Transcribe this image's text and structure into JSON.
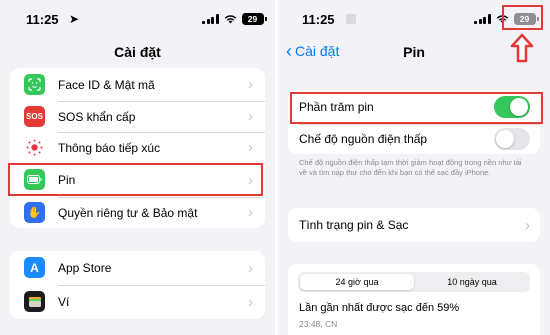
{
  "colors": {
    "accent": "#007aff",
    "toggle_on": "#34c759",
    "highlight": "#e53935",
    "face_id_icon": "#34c759",
    "sos_icon": "#e53935",
    "exposure_icon": "#ffffff",
    "battery_icon": "#34c759",
    "privacy_icon": "#2f6ff0",
    "app_store_icon": "#1a8cff",
    "wallet_icon": "#1c1c1e"
  },
  "left": {
    "status": {
      "time": "11:25",
      "battery": "29"
    },
    "nav_title": "Cài đặt",
    "group1": [
      {
        "label": "Face ID & Mật mã",
        "icon": "face-id-icon",
        "glyph": "☺"
      },
      {
        "label": "SOS khẩn cấp",
        "icon": "sos-icon",
        "glyph": "SOS"
      },
      {
        "label": "Thông báo tiếp xúc",
        "icon": "exposure-notification-icon",
        "glyph": ""
      },
      {
        "label": "Pin",
        "icon": "battery-icon",
        "glyph": ""
      },
      {
        "label": "Quyền riêng tư & Bảo mật",
        "icon": "privacy-hand-icon",
        "glyph": "✋"
      }
    ],
    "group2": [
      {
        "label": "App Store",
        "icon": "app-store-icon",
        "glyph": "A"
      },
      {
        "label": "Ví",
        "icon": "wallet-icon",
        "glyph": ""
      }
    ]
  },
  "right": {
    "status": {
      "time": "11:25",
      "battery": "29"
    },
    "back_label": "Cài đặt",
    "nav_title": "Pin",
    "battery_percentage": {
      "label": "Phần trăm pin",
      "enabled": true
    },
    "low_power": {
      "label": "Chế độ nguồn điện thấp",
      "enabled": false
    },
    "low_power_note": "Chế độ nguồn điện thấp tạm thời giảm hoạt động trong nền như tải về và tìm nạp thư cho đến khi bạn có thể sạc đầy iPhone.",
    "health_label": "Tình trạng pin & Sạc",
    "tabs": [
      "24 giờ qua",
      "10 ngày qua"
    ],
    "last_charged": "Lần gần nhất được sạc đến 59%",
    "last_charged_time": "23:48, CN"
  }
}
